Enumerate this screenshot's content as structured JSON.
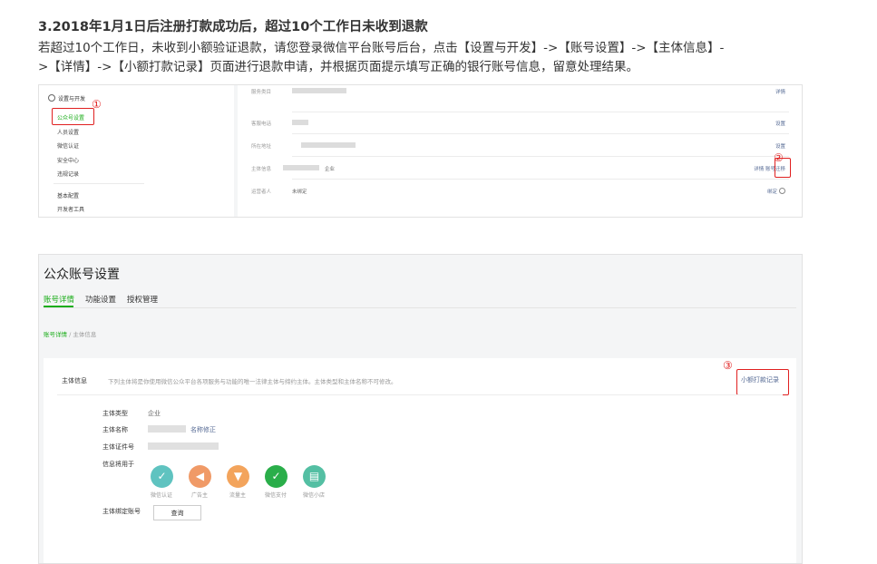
{
  "article": {
    "heading": "3.2018年1月1日后注册打款成功后，超过10个工作日未收到退款",
    "paragraph_line1": "若超过10个工作日，未收到小额验证退款，请您登录微信平台账号后台，点击【设置与开发】->【账号设置】->【主体信息】-",
    "paragraph_line2": ">【详情】->【小额打款记录】页面进行退款申请，并根据页面提示填写正确的银行账号信息，留意处理结果。"
  },
  "screenshot1": {
    "menu_header": "设置与开发",
    "menu_items": [
      "公众号设置",
      "人员设置",
      "微信认证",
      "安全中心",
      "违规记录"
    ],
    "menu_items_lower": [
      "基本配置",
      "开发者工具"
    ],
    "rows": [
      {
        "label": "服务类目",
        "action": "详情"
      },
      {
        "label": "客服电话",
        "action": "设置"
      },
      {
        "label": "所在地址",
        "action": "设置"
      },
      {
        "label": "主体信息",
        "value_suffix": "企业",
        "action": "详情 账号迁移"
      },
      {
        "label": "运营者人",
        "value": "未绑定",
        "action": "绑定"
      }
    ],
    "marker1": "①",
    "marker2": "②"
  },
  "screenshot2": {
    "title": "公众账号设置",
    "tabs": [
      "账号详情",
      "功能设置",
      "授权管理"
    ],
    "breadcrumb_link": "账号详情",
    "breadcrumb_sep": " / ",
    "breadcrumb_current": "主体信息",
    "section_label": "主体信息",
    "section_desc": "下列主体将是你使用微信公众平台各项服务与功能的唯一法律主体与缔约主体。主体类型和主体名称不可修改。",
    "record_link": "小额打款记录",
    "marker3": "③",
    "fields": {
      "type_label": "主体类型",
      "type_value": "企业",
      "name_label": "主体名称",
      "name_link": "名称修正",
      "id_label": "主体证件号",
      "use_label": "信息将用于",
      "bind_label": "主体绑定账号",
      "query_button": "查询"
    },
    "uses": [
      {
        "label": "微信认证",
        "color": "#5fc3c0",
        "glyph": "✓"
      },
      {
        "label": "广告主",
        "color": "#f09a67",
        "glyph": "◀"
      },
      {
        "label": "流量主",
        "color": "#f3a45c",
        "glyph": "▼"
      },
      {
        "label": "微信支付",
        "color": "#2aae4a",
        "glyph": "✓"
      },
      {
        "label": "微信小店",
        "color": "#54bfa3",
        "glyph": "▤"
      }
    ]
  },
  "colors": {
    "accent_green": "#1aad19",
    "link_blue": "#576b95",
    "highlight_red": "#e02020"
  }
}
